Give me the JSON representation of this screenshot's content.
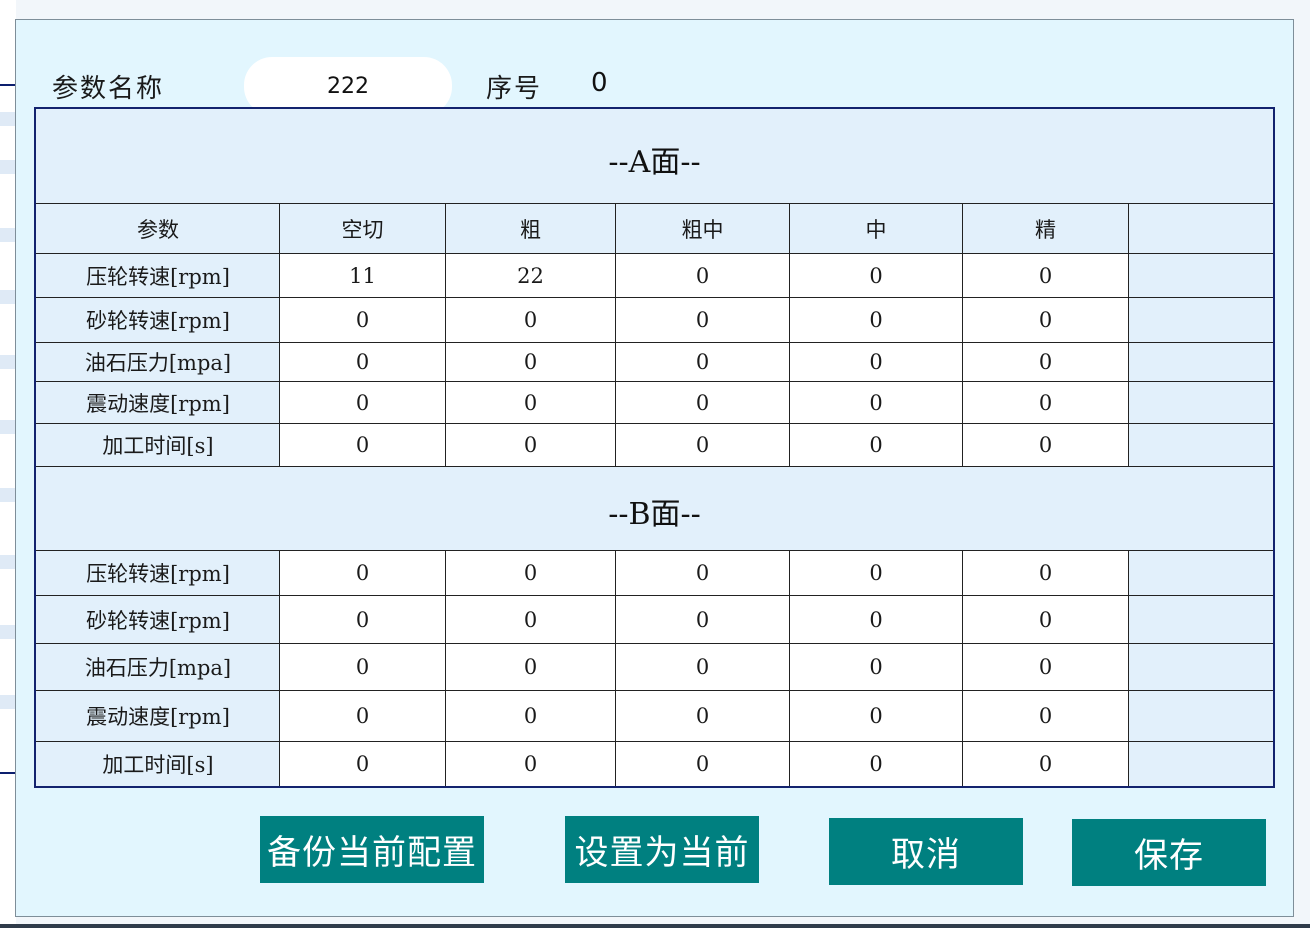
{
  "header": {
    "name_label": "参数名称",
    "name_value": "222",
    "seq_label": "序号",
    "seq_value": "0"
  },
  "table": {
    "section_a_title": "--A面--",
    "section_b_title": "--B面--",
    "columns": [
      "参数",
      "空切",
      "粗",
      "粗中",
      "中",
      "精"
    ],
    "section_a_rows": [
      {
        "label": "压轮转速[rpm]",
        "values": [
          "11",
          "22",
          "0",
          "0",
          "0"
        ]
      },
      {
        "label": "砂轮转速[rpm]",
        "values": [
          "0",
          "0",
          "0",
          "0",
          "0"
        ]
      },
      {
        "label": "油石压力[mpa]",
        "values": [
          "0",
          "0",
          "0",
          "0",
          "0"
        ]
      },
      {
        "label": "震动速度[rpm]",
        "values": [
          "0",
          "0",
          "0",
          "0",
          "0"
        ]
      },
      {
        "label": "加工时间[s]",
        "values": [
          "0",
          "0",
          "0",
          "0",
          "0"
        ]
      }
    ],
    "section_b_rows": [
      {
        "label": "压轮转速[rpm]",
        "values": [
          "0",
          "0",
          "0",
          "0",
          "0"
        ]
      },
      {
        "label": "砂轮转速[rpm]",
        "values": [
          "0",
          "0",
          "0",
          "0",
          "0"
        ]
      },
      {
        "label": "油石压力[mpa]",
        "values": [
          "0",
          "0",
          "0",
          "0",
          "0"
        ]
      },
      {
        "label": "震动速度[rpm]",
        "values": [
          "0",
          "0",
          "0",
          "0",
          "0"
        ]
      },
      {
        "label": "加工时间[s]",
        "values": [
          "0",
          "0",
          "0",
          "0",
          "0"
        ]
      }
    ]
  },
  "buttons": {
    "backup": "备份当前配置",
    "set_current": "设置为当前",
    "cancel": "取消",
    "save": "保存"
  },
  "colors": {
    "button_bg": "#008080",
    "dialog_bg": "#e2f6fe",
    "table_border": "#13236e"
  }
}
